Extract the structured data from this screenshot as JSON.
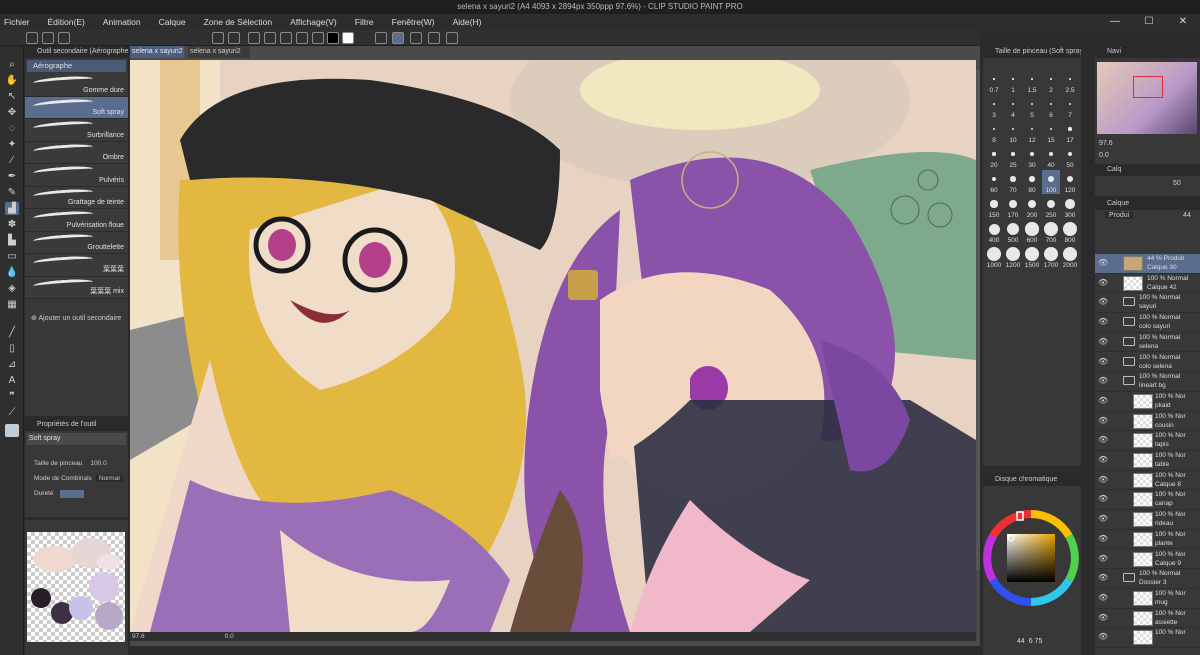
{
  "window": {
    "title": "selena x sayuri2 (A4 4093 x 2894px 350ppp 97.6%) - CLIP STUDIO PAINT PRO",
    "minimize": "—",
    "maximize": "☐",
    "close": "✕"
  },
  "menu": [
    "Fichier",
    "Édition(E)",
    "Animation",
    "Calque",
    "Zone de Sélection",
    "Affichage(V)",
    "Filtre",
    "Fenêtre(W)",
    "Aide(H)"
  ],
  "subtool": {
    "panel_title": "Outil secondaire (Aérographe)",
    "tab": "Aérographe",
    "brushes": [
      "Gomme dure",
      "Soft spray",
      "Surbrillance",
      "Ombre",
      "Pulvéris",
      "Grattage de teinte",
      "Pulvérisation floue",
      "Grouttelette",
      "葉葉葉",
      "葉葉葉 mix"
    ],
    "selected": "Soft spray",
    "add_label": "Ajouter un outil secondaire"
  },
  "tool_property": {
    "title": "Propriétés de l'outil",
    "name": "Soft spray",
    "size_label": "Taille de pinceau",
    "size_value": "100.0",
    "blend_label": "Mode de Combinais",
    "blend_value": "Normal",
    "hardness_label": "Dureté"
  },
  "document": {
    "tab_active": "selena x sayuri2",
    "tab_other": "selena x sayuri2"
  },
  "status": {
    "zoom": "97.6",
    "rotation": "0.0"
  },
  "brush_size": {
    "title": "Taille de pinceau (Soft spray)",
    "sizes": [
      "0.7",
      "1",
      "1.5",
      "2",
      "2.5",
      "3",
      "4",
      "5",
      "6",
      "7",
      "8",
      "10",
      "12",
      "15",
      "17",
      "20",
      "25",
      "30",
      "40",
      "50",
      "60",
      "70",
      "80",
      "100",
      "120",
      "150",
      "170",
      "200",
      "250",
      "300",
      "400",
      "500",
      "600",
      "700",
      "800",
      "1000",
      "1200",
      "1500",
      "1700",
      "2000"
    ],
    "selected": "100"
  },
  "color_wheel": {
    "title": "Disque chromatique",
    "h": "44",
    "s": "6",
    "v": "75",
    "hue_color": "#e8a000"
  },
  "navigator": {
    "title": "Navi",
    "zoom": "97.6",
    "rotation": "0.0"
  },
  "layer_property": {
    "title": "Calq",
    "opacity": "50"
  },
  "layers_panel": {
    "title": "Calque",
    "blend": "Produi",
    "opacity": "44"
  },
  "layers": [
    {
      "meta": "44 % Produit",
      "name": "Calque 30",
      "kind": "layer",
      "selected": true,
      "thumb": "#c8a574"
    },
    {
      "meta": "100 % Normal",
      "name": "Calque 42",
      "kind": "layer"
    },
    {
      "meta": "100 % Normal",
      "name": "sayuri",
      "kind": "folder"
    },
    {
      "meta": "100 % Normal",
      "name": "colo sayuri",
      "kind": "folder"
    },
    {
      "meta": "100 % Normal",
      "name": "selena",
      "kind": "folder"
    },
    {
      "meta": "100 % Normal",
      "name": "colo selena",
      "kind": "folder"
    },
    {
      "meta": "100 % Normal",
      "name": "lineart bg",
      "kind": "folder",
      "open": true
    },
    {
      "meta": "100 % Nor",
      "name": "pkaid",
      "kind": "sub"
    },
    {
      "meta": "100 % Nor",
      "name": "cousin",
      "kind": "sub"
    },
    {
      "meta": "100 % Nor",
      "name": "tapis",
      "kind": "sub"
    },
    {
      "meta": "100 % Nor",
      "name": "table",
      "kind": "sub"
    },
    {
      "meta": "100 % Nor",
      "name": "Calque 8",
      "kind": "sub"
    },
    {
      "meta": "100 % Nor",
      "name": "canap",
      "kind": "sub"
    },
    {
      "meta": "100 % Nor",
      "name": "rideau",
      "kind": "sub"
    },
    {
      "meta": "100 % Nor",
      "name": "plante",
      "kind": "sub"
    },
    {
      "meta": "100 % Nor",
      "name": "Calque 9",
      "kind": "sub"
    },
    {
      "meta": "100 % Normal",
      "name": "Dossier 3",
      "kind": "folder",
      "open": true
    },
    {
      "meta": "100 % Nor",
      "name": "mug",
      "kind": "sub"
    },
    {
      "meta": "100 % Nor",
      "name": "assiette",
      "kind": "sub"
    },
    {
      "meta": "100 % Nor",
      "name": "",
      "kind": "sub"
    }
  ],
  "colors": {
    "accent": "#5b6d8e",
    "panel": "#383838",
    "background": "#2b2b2b"
  }
}
